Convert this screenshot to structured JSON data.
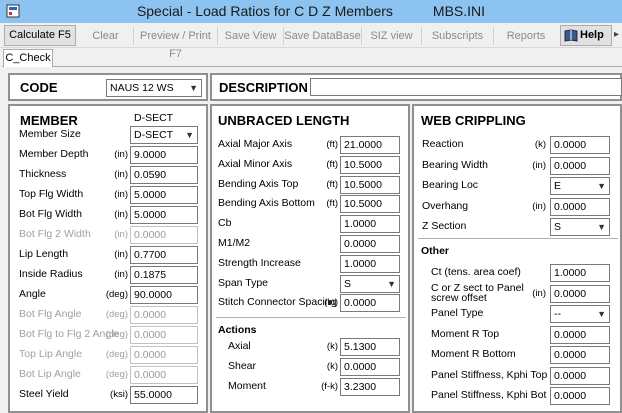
{
  "window": {
    "title": "Special - Load Ratios for C D Z Members",
    "ini": "MBS.INI"
  },
  "toolbar": {
    "calculate": "Calculate  F5",
    "clear": "Clear",
    "preview": "Preview / Print F7",
    "save_view": "Save View",
    "save_database": "Save DataBase",
    "siz_view": "SIZ view",
    "subscripts": "Subscripts",
    "reports": "Reports",
    "help": "Help",
    "help_caret": "▸"
  },
  "tab": "C_Check",
  "code": {
    "label": "CODE",
    "value": "NAUS 12 WS"
  },
  "description": {
    "label": "DESCRIPTION",
    "value": ""
  },
  "member": {
    "heading": "MEMBER",
    "section": "D-SECT",
    "rows": [
      {
        "label": "Member Size",
        "unit": "",
        "value": "D-SECT",
        "type": "select",
        "enabled": true
      },
      {
        "label": "Member Depth",
        "unit": "(in)",
        "value": "9.0000",
        "enabled": true
      },
      {
        "label": "Thickness",
        "unit": "(in)",
        "value": "0.0590",
        "enabled": true
      },
      {
        "label": "Top Flg Width",
        "unit": "(in)",
        "value": "5.0000",
        "enabled": true
      },
      {
        "label": "Bot Flg Width",
        "unit": "(in)",
        "value": "5.0000",
        "enabled": true
      },
      {
        "label": "Bot Flg 2 Width",
        "unit": "(in)",
        "value": "0.0000",
        "enabled": false
      },
      {
        "label": "Lip Length",
        "unit": "(in)",
        "value": "0.7700",
        "enabled": true
      },
      {
        "label": "Inside Radius",
        "unit": "(in)",
        "value": "0.1875",
        "enabled": true
      },
      {
        "label": "Angle",
        "unit": "(deg)",
        "value": "90.0000",
        "enabled": true
      },
      {
        "label": "Bot Flg Angle",
        "unit": "(deg)",
        "value": "0.0000",
        "enabled": false
      },
      {
        "label": "Bot Flg to Flg 2 Angle",
        "unit": "(deg)",
        "value": "0.0000",
        "enabled": false
      },
      {
        "label": "Top Lip Angle",
        "unit": "(deg)",
        "value": "0.0000",
        "enabled": false
      },
      {
        "label": "Bot Lip Angle",
        "unit": "(deg)",
        "value": "0.0000",
        "enabled": false
      },
      {
        "label": "Steel Yield",
        "unit": "(ksi)",
        "value": "55.0000",
        "enabled": true
      }
    ]
  },
  "unbraced": {
    "heading": "UNBRACED LENGTH",
    "rows": [
      {
        "label": "Axial Major Axis",
        "unit": "(ft)",
        "value": "21.0000"
      },
      {
        "label": "Axial Minor Axis",
        "unit": "(ft)",
        "value": "10.5000"
      },
      {
        "label": "Bending Axis Top",
        "unit": "(ft)",
        "value": "10.5000"
      },
      {
        "label": "Bending Axis Bottom",
        "unit": "(ft)",
        "value": "10.5000"
      },
      {
        "label": "Cb",
        "unit": "",
        "value": "1.0000"
      },
      {
        "label": "M1/M2",
        "unit": "",
        "value": "0.0000"
      },
      {
        "label": "Strength Increase",
        "unit": "",
        "value": "1.0000"
      },
      {
        "label": "Span Type",
        "unit": "",
        "value": "S",
        "type": "select"
      },
      {
        "label": "Stitch Connector Spacing",
        "unit": "(in)",
        "value": "0.0000"
      }
    ],
    "actions_heading": "Actions",
    "actions": [
      {
        "label": "Axial",
        "unit": "(k)",
        "value": "5.1300"
      },
      {
        "label": "Shear",
        "unit": "(k)",
        "value": "0.0000"
      },
      {
        "label": "Moment",
        "unit": "(f-k)",
        "value": "3.2300"
      }
    ]
  },
  "web": {
    "heading": "WEB CRIPPLING",
    "rows": [
      {
        "label": "Reaction",
        "unit": "(k)",
        "value": "0.0000"
      },
      {
        "label": "Bearing Width",
        "unit": "(in)",
        "value": "0.0000"
      },
      {
        "label": "Bearing Loc",
        "unit": "",
        "value": "E",
        "type": "select"
      },
      {
        "label": "Overhang",
        "unit": "(in)",
        "value": "0.0000"
      },
      {
        "label": "Z Section",
        "unit": "",
        "value": "S",
        "type": "select"
      }
    ],
    "other_heading": "Other",
    "other": [
      {
        "label": "Ct (tens. area coef)",
        "unit": "",
        "value": "1.0000"
      },
      {
        "label": "C or Z sect to Panel",
        "label2": "screw offset",
        "unit": "(in)",
        "value": "0.0000"
      },
      {
        "label": "Panel Type",
        "unit": "",
        "value": "--",
        "type": "select"
      },
      {
        "label": "Moment R Top",
        "unit": "",
        "value": "0.0000"
      },
      {
        "label": "Moment R Bottom",
        "unit": "",
        "value": "0.0000"
      },
      {
        "label": "Panel Stiffness, Kphi Top",
        "unit": "",
        "value": "0.0000"
      },
      {
        "label": "Panel Stiffness, Kphi Bot",
        "unit": "",
        "value": "0.0000"
      }
    ]
  }
}
